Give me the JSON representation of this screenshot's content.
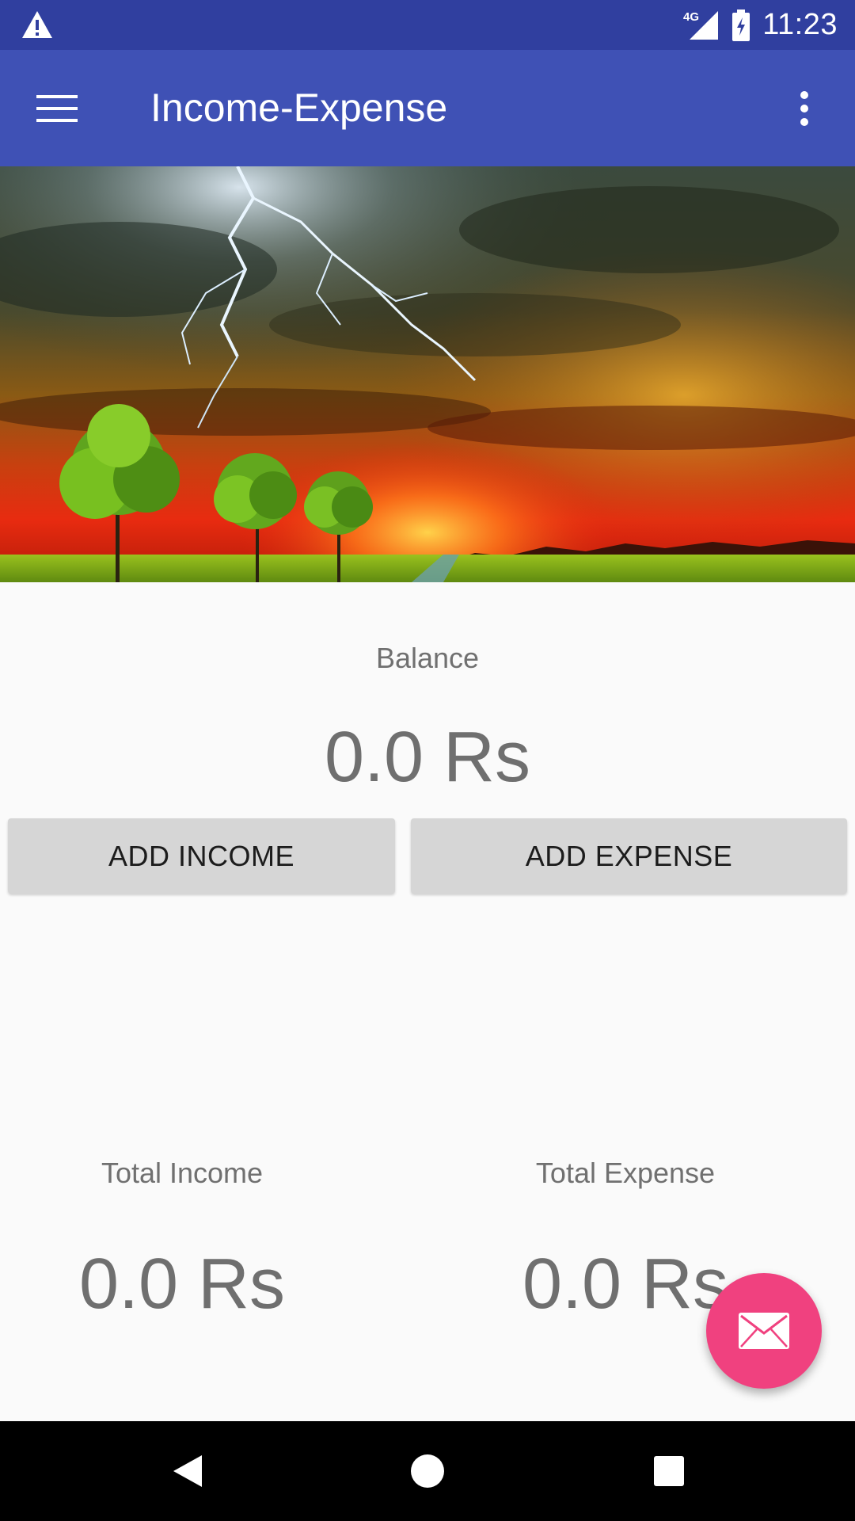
{
  "status_bar": {
    "time": "11:23",
    "network_label": "4G",
    "icons": [
      "warning-icon",
      "signal-icon",
      "battery-charging-icon"
    ]
  },
  "app_bar": {
    "title": "Income-Expense",
    "menu_icon": "hamburger-menu-icon",
    "overflow_icon": "more-vert-icon",
    "color": "#3f51b5"
  },
  "header_image": {
    "description_icon": "storm-sunset-landscape-image"
  },
  "balance": {
    "label": "Balance",
    "value": "0.0 Rs"
  },
  "buttons": {
    "add_income": "ADD INCOME",
    "add_expense": "ADD EXPENSE"
  },
  "totals": {
    "income_label": "Total Income",
    "income_value": "0.0 Rs",
    "expense_label": "Total Expense",
    "expense_value": "0.0 Rs"
  },
  "fab": {
    "icon": "mail-icon",
    "color": "#f0417f"
  },
  "nav_bar": {
    "icons": [
      "back-icon",
      "home-icon",
      "recents-icon"
    ]
  }
}
